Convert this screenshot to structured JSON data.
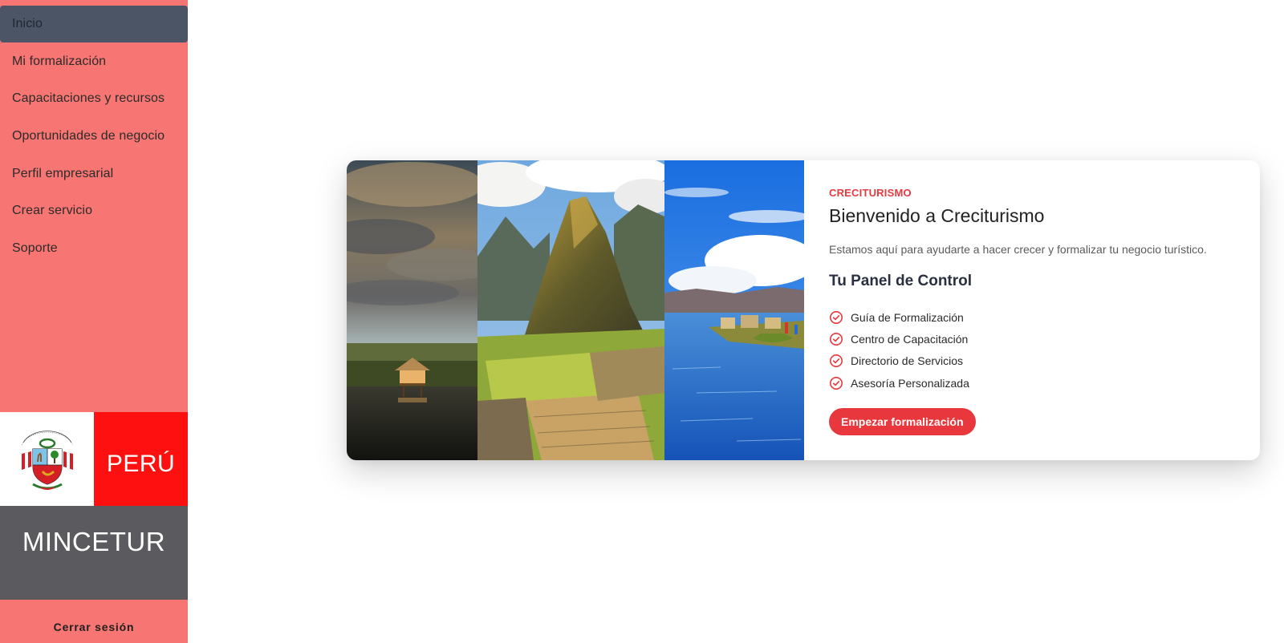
{
  "sidebar": {
    "items": [
      {
        "label": "Inicio",
        "active": true
      },
      {
        "label": "Mi formalización"
      },
      {
        "label": "Capacitaciones y recursos"
      },
      {
        "label": "Oportunidades de negocio"
      },
      {
        "label": "Perfil empresarial"
      },
      {
        "label": "Crear servicio"
      },
      {
        "label": "Soporte"
      }
    ],
    "country_label": "PERÚ",
    "ministry_label": "MINCETUR",
    "logout_label": "Cerrar sesión",
    "accent_color": "#f77572"
  },
  "welcome": {
    "eyebrow": "CRECITURISMO",
    "title": "Bienvenido a Creciturismo",
    "description": "Estamos aquí para ayudarte a hacer crecer y formalizar tu negocio turístico.",
    "panel_title": "Tu Panel de Control",
    "features": [
      "Guía de Formalización",
      "Centro de Capacitación",
      "Directorio de Servicios",
      "Asesoría Personalizada"
    ],
    "cta_label": "Empezar formalización",
    "accent_color": "#e8383d"
  }
}
